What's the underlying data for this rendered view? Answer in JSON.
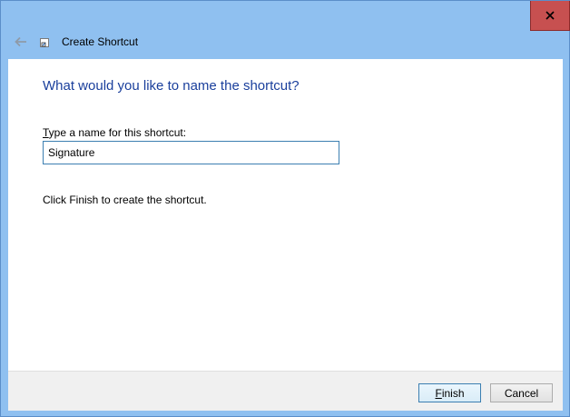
{
  "window": {
    "title": "Create Shortcut",
    "close_icon": "close-icon",
    "back_icon": "back-arrow-icon",
    "app_icon": "shortcut-icon",
    "close_color": "#c75050",
    "frame_color": "#8fc0f0"
  },
  "main": {
    "heading": "What would you like to name the shortcut?",
    "label_mnemonic": "T",
    "label_rest": "ype a name for this shortcut:",
    "name_value": "Signature",
    "hint": "Click Finish to create the shortcut.",
    "heading_color": "#1a3f9c"
  },
  "footer": {
    "finish_mnemonic": "F",
    "finish_rest": "inish",
    "cancel_label": "Cancel"
  }
}
